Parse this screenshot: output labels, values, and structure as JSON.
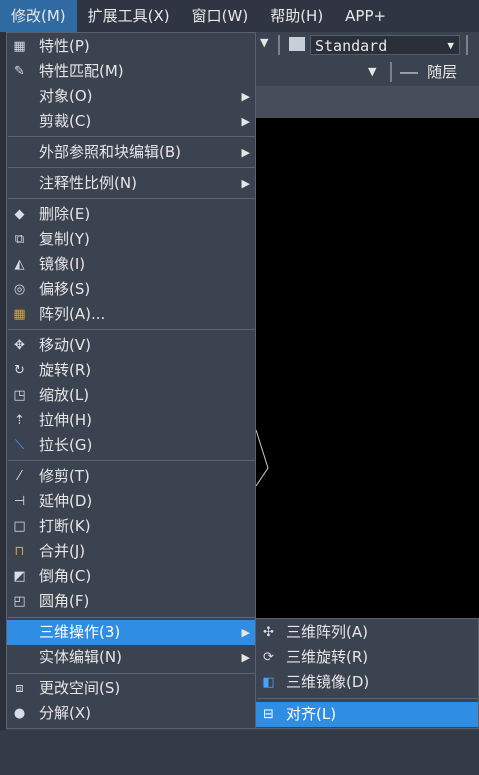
{
  "menubar": [
    {
      "label": "修改(M)",
      "active": true
    },
    {
      "label": "扩展工具(X)"
    },
    {
      "label": "窗口(W)"
    },
    {
      "label": "帮助(H)"
    },
    {
      "label": "APP+"
    }
  ],
  "toolbar": {
    "style_combo": "Standard",
    "layer_combo": "—— 随层"
  },
  "menu": {
    "items": [
      {
        "label": "特性(P)",
        "icon": "properties-icon"
      },
      {
        "label": "特性匹配(M)",
        "icon": "match-properties-icon"
      },
      {
        "label": "对象(O)"
      },
      {
        "label": "剪裁(C)"
      },
      {
        "label": "外部参照和块编辑(B)"
      },
      {
        "label": "注释性比例(N)"
      },
      {
        "label": "删除(E)",
        "icon": "eraser-icon"
      },
      {
        "label": "复制(Y)",
        "icon": "copy-icon"
      },
      {
        "label": "镜像(I)",
        "icon": "mirror-icon"
      },
      {
        "label": "偏移(S)",
        "icon": "offset-icon"
      },
      {
        "label": "阵列(A)...",
        "icon": "array-icon"
      },
      {
        "label": "移动(V)",
        "icon": "move-icon"
      },
      {
        "label": "旋转(R)",
        "icon": "rotate-icon"
      },
      {
        "label": "缩放(L)",
        "icon": "scale-icon"
      },
      {
        "label": "拉伸(H)",
        "icon": "stretch-icon"
      },
      {
        "label": "拉长(G)",
        "icon": "lengthen-icon"
      },
      {
        "label": "修剪(T)",
        "icon": "trim-icon"
      },
      {
        "label": "延伸(D)",
        "icon": "extend-icon"
      },
      {
        "label": "打断(K)",
        "icon": "break-icon"
      },
      {
        "label": "合并(J)",
        "icon": "join-icon"
      },
      {
        "label": "倒角(C)",
        "icon": "chamfer-icon"
      },
      {
        "label": "圆角(F)",
        "icon": "fillet-icon"
      },
      {
        "label": "三维操作(3)"
      },
      {
        "label": "实体编辑(N)"
      },
      {
        "label": "更改空间(S)",
        "icon": "change-space-icon"
      },
      {
        "label": "分解(X)",
        "icon": "explode-icon"
      }
    ]
  },
  "submenu": {
    "items": [
      {
        "label": "三维阵列(A)",
        "icon": "3d-array-icon"
      },
      {
        "label": "三维旋转(R)",
        "icon": "3d-rotate-icon"
      },
      {
        "label": "三维镜像(D)",
        "icon": "3d-mirror-icon"
      },
      {
        "label": "对齐(L)",
        "icon": "align-icon"
      }
    ]
  },
  "colors": {
    "highlight": "#2f8de4",
    "menu_bg": "#3b4250",
    "menubar_active": "#2f6aa3"
  }
}
